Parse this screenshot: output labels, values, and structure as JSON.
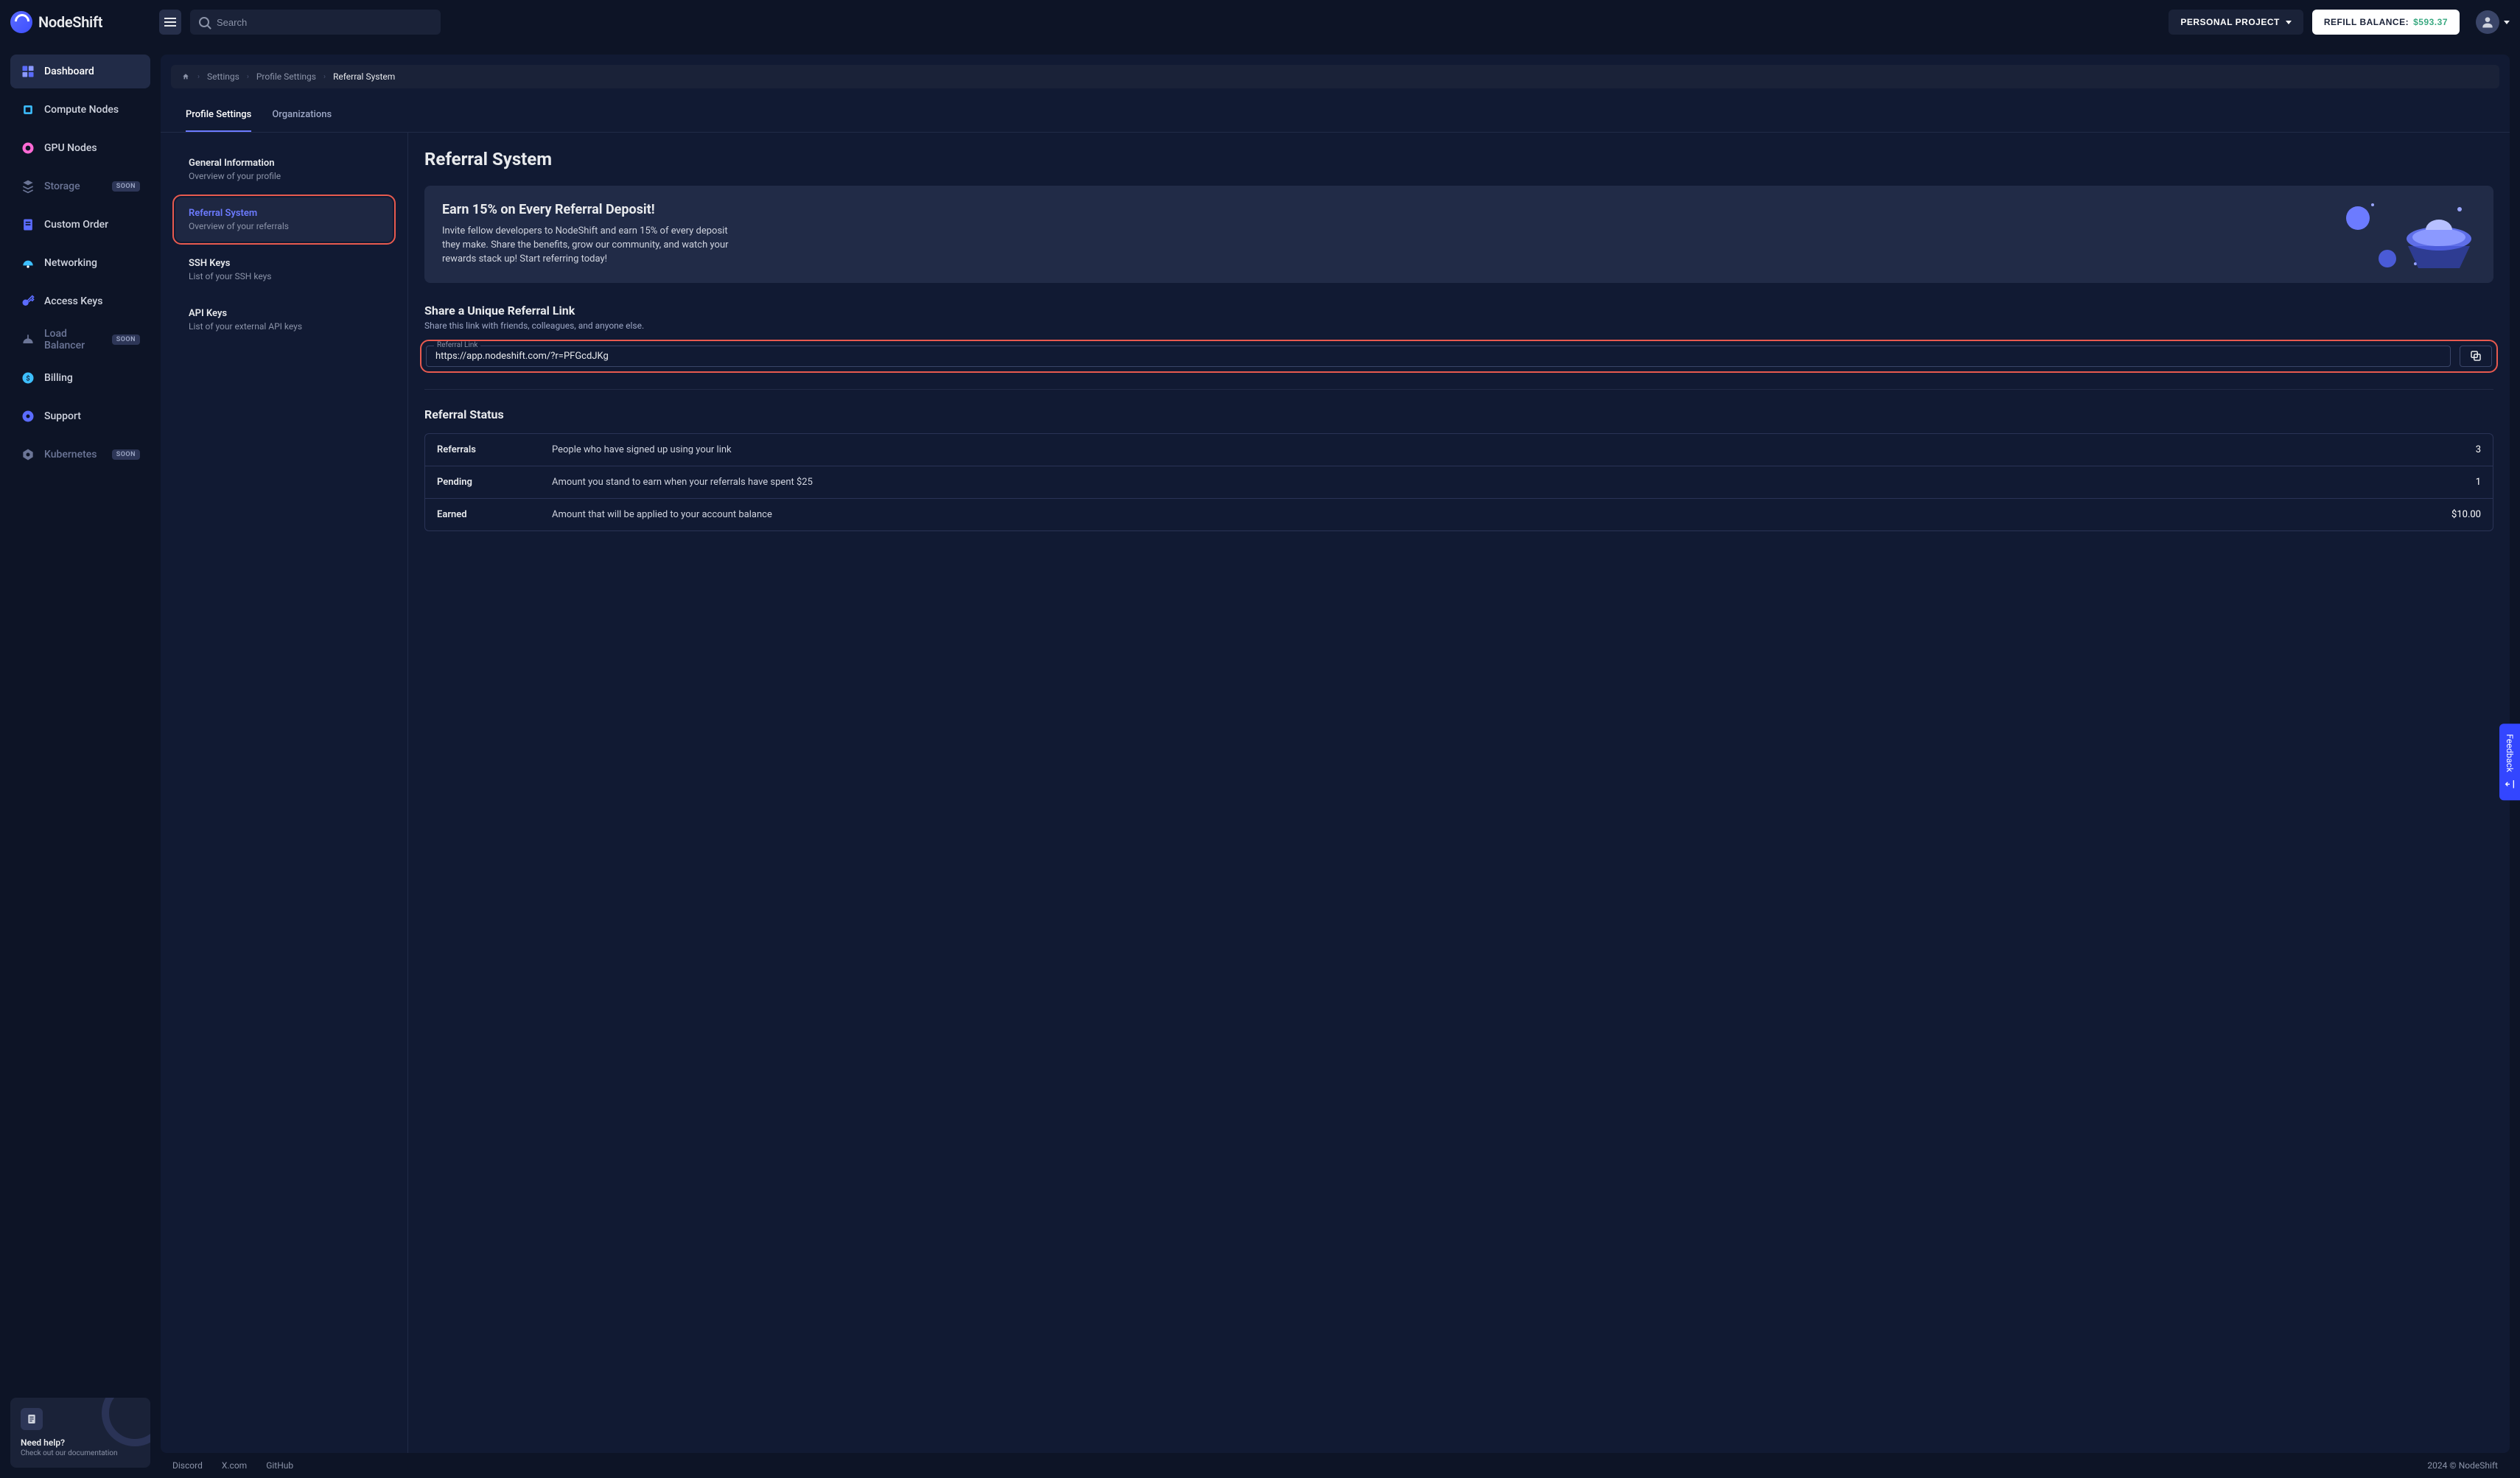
{
  "brand": {
    "name": "NodeShift"
  },
  "header": {
    "search_placeholder": "Search",
    "project_label": "PERSONAL PROJECT",
    "refill_label": "REFILL BALANCE:",
    "refill_amount": "$593.37"
  },
  "sidebar": {
    "items": [
      {
        "label": "Dashboard",
        "icon": "dashboard-icon",
        "active": true
      },
      {
        "label": "Compute Nodes",
        "icon": "compute-icon"
      },
      {
        "label": "GPU Nodes",
        "icon": "gpu-icon"
      },
      {
        "label": "Storage",
        "icon": "storage-icon",
        "soon": true,
        "dim": true
      },
      {
        "label": "Custom Order",
        "icon": "custom-icon"
      },
      {
        "label": "Networking",
        "icon": "networking-icon"
      },
      {
        "label": "Access Keys",
        "icon": "keys-icon"
      },
      {
        "label": "Load Balancer",
        "icon": "lb-icon",
        "soon": true,
        "dim": true
      },
      {
        "label": "Billing",
        "icon": "billing-icon"
      },
      {
        "label": "Support",
        "icon": "support-icon"
      },
      {
        "label": "Kubernetes",
        "icon": "k8s-icon",
        "soon": true,
        "dim": true
      }
    ],
    "soon_badge": "SOON",
    "help": {
      "title": "Need help?",
      "sub": "Check out our documentation"
    }
  },
  "breadcrumb": {
    "items": [
      "Settings",
      "Profile Settings",
      "Referral System"
    ]
  },
  "tabs": {
    "items": [
      "Profile Settings",
      "Organizations"
    ],
    "active": 0
  },
  "subnav": {
    "items": [
      {
        "title": "General Information",
        "sub": "Overview of your profile"
      },
      {
        "title": "Referral System",
        "sub": "Overview of your referrals",
        "active": true
      },
      {
        "title": "SSH Keys",
        "sub": "List of your SSH keys"
      },
      {
        "title": "API Keys",
        "sub": "List of your external API keys"
      }
    ]
  },
  "main": {
    "title": "Referral System",
    "hero": {
      "title": "Earn 15% on Every Referral Deposit!",
      "text": "Invite fellow developers to NodeShift and earn 15% of every deposit they make. Share the benefits, grow our community, and watch your rewards stack up! Start referring today!"
    },
    "share": {
      "title": "Share a Unique Referral Link",
      "sub": "Share this link with friends, colleagues, and anyone else.",
      "field_label": "Referral Link",
      "link": "https://app.nodeshift.com/?r=PFGcdJKg"
    },
    "status": {
      "title": "Referral Status",
      "rows": [
        {
          "label": "Referrals",
          "desc": "People who have signed up using your link",
          "value": "3"
        },
        {
          "label": "Pending",
          "desc": "Amount you stand to earn when your referrals have spent $25",
          "value": "1"
        },
        {
          "label": "Earned",
          "desc": "Amount that will be applied to your account balance",
          "value": "$10.00"
        }
      ]
    }
  },
  "footer": {
    "links": [
      "Discord",
      "X.com",
      "GitHub"
    ],
    "copyright": "2024 © NodeShift"
  },
  "feedback": {
    "label": "Feedback"
  }
}
